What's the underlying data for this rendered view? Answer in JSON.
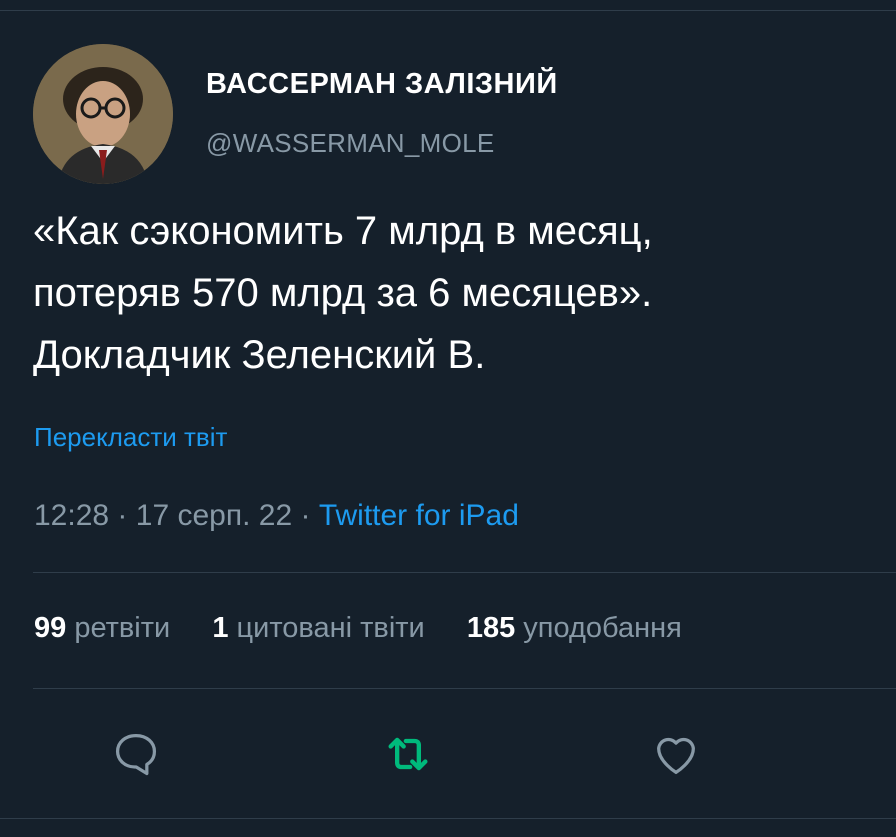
{
  "author": {
    "display_name": "ВАССЕРМАН ЗАЛІЗНИЙ",
    "handle": "@WASSERMAN_MOLE",
    "avatar_icon": "avatar-photo"
  },
  "tweet": {
    "lines": [
      "«Как сэкономить 7 млрд в месяц,",
      "потеряв 570 млрд за 6 месяцев».",
      "Докладчик Зеленский В."
    ],
    "translate_label": "Перекласти твіт",
    "time": "12:28",
    "date": "17 серп. 22",
    "separator": "·",
    "source": "Twitter for iPad"
  },
  "stats": {
    "retweets_count": "99",
    "retweets_label": "ретвіти",
    "quotes_count": "1",
    "quotes_label": "цитовані твіти",
    "likes_count": "185",
    "likes_label": "уподобання"
  },
  "actions": {
    "reply_icon": "reply-icon",
    "retweet_icon": "retweet-icon",
    "like_icon": "heart-icon"
  },
  "colors": {
    "background": "#15202b",
    "link": "#1d9bf0",
    "secondary_text": "#8899a6",
    "retweet_active": "#00ba7c"
  }
}
